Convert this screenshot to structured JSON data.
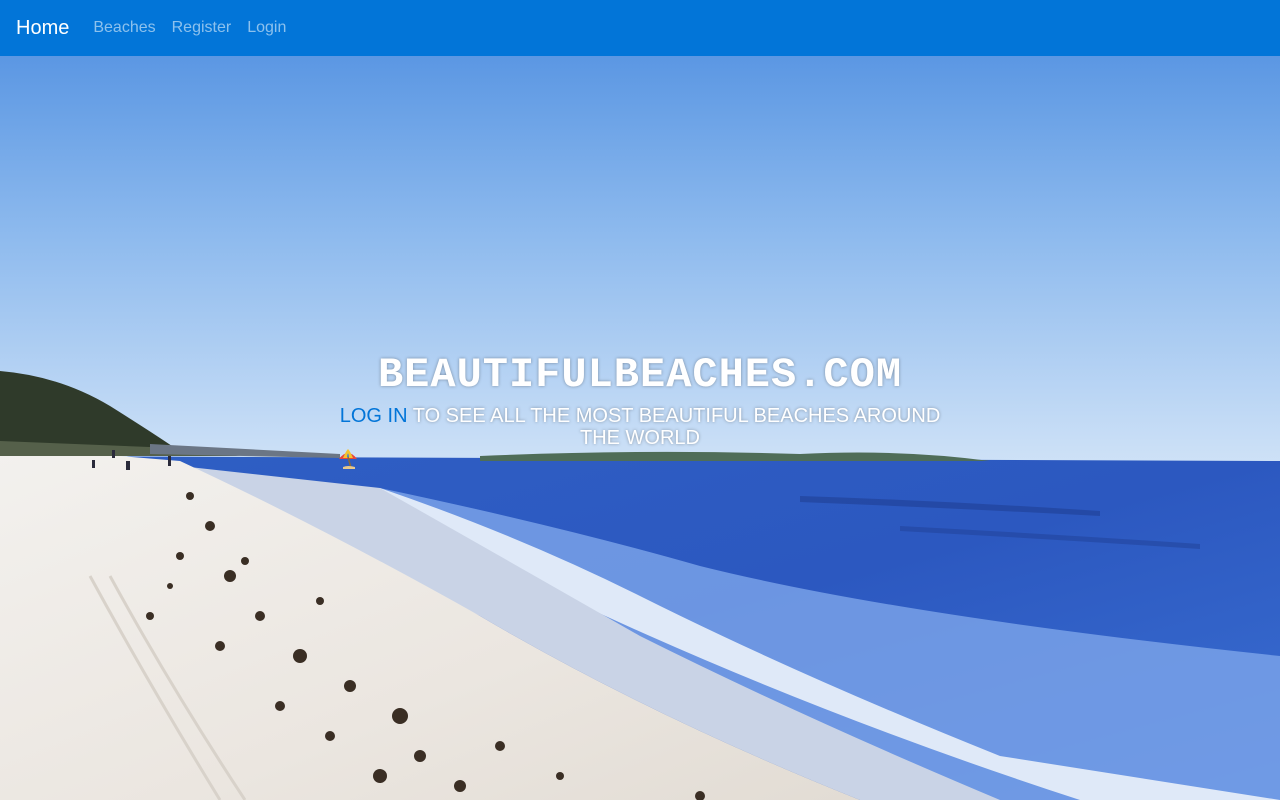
{
  "navbar": {
    "brand": "Home",
    "links": [
      "Beaches",
      "Register",
      "Login"
    ],
    "background": "#0275d8"
  },
  "hero": {
    "title": "BEAUTIFULBEACHES.COM",
    "subtitle_link": "LOG IN",
    "subtitle_text": " TO SEE ALL THE MOST BEAUTIFUL BEACHES AROUND THE WORLD ",
    "subtitle_icon": "beach-umbrella-icon",
    "link_color": "#0275d8"
  }
}
